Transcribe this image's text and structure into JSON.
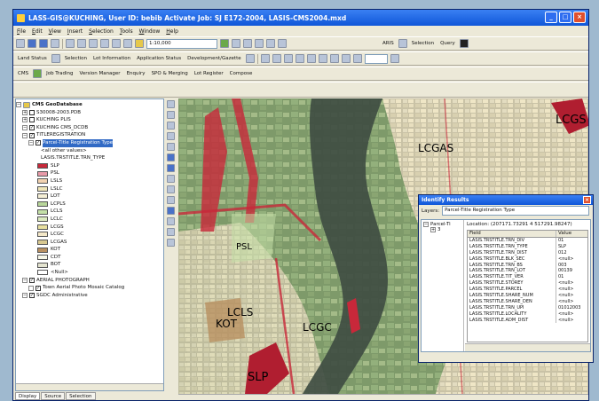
{
  "window": {
    "title": "LASS-GIS@KUCHING, User ID: bebib    Activate Job: SJ E172-2004,      LASIS-CMS2004.mxd"
  },
  "menu": [
    "File",
    "Edit",
    "View",
    "Insert",
    "Selection",
    "Tools",
    "Window",
    "Help"
  ],
  "toolbar1": {
    "scale": "1:10,000",
    "arcis_label": "ARIS",
    "selection_label": "Selection",
    "query_label": "Query"
  },
  "toolbar2": {
    "items": [
      "Land Status",
      "Selection",
      "Lot Information",
      "Application Status",
      "Development/Gazette"
    ]
  },
  "toolbar3": {
    "items": [
      "CMS",
      "Job Trading",
      "Version Manager",
      "Enquiry",
      "SPO & Merging",
      "Lot Register",
      "Compose"
    ]
  },
  "toc": {
    "root": "CMS GeoDatabase",
    "items": [
      {
        "label": "S30008-2003.PDB",
        "checked": false,
        "indent": 1
      },
      {
        "label": "KUCHING PLIS",
        "checked": false,
        "indent": 1
      },
      {
        "label": "KUCHING CMS_DCDB",
        "checked": true,
        "indent": 1
      },
      {
        "label": "TITLEREGISTRATION",
        "checked": true,
        "indent": 1
      },
      {
        "label": "Parcel-Title Registration Type",
        "checked": true,
        "indent": 2,
        "selected": true
      },
      {
        "label": "<all other values>",
        "indent": 4
      },
      {
        "label": "LASIS.TRSTITLE.TRN_TYPE",
        "indent": 4
      }
    ],
    "legend": [
      {
        "label": "SLP",
        "color": "#c8283a"
      },
      {
        "label": "PSL",
        "color": "#e89aa8"
      },
      {
        "label": "LSLS",
        "color": "#f2d2b0"
      },
      {
        "label": "LSLC",
        "color": "#f0e6b8"
      },
      {
        "label": "LOT",
        "color": "#f6f0d6"
      },
      {
        "label": "LCPLS",
        "color": "#b8d69a"
      },
      {
        "label": "LCLS",
        "color": "#c4e0a8"
      },
      {
        "label": "LCLC",
        "color": "#dcebc0"
      },
      {
        "label": "LCGS",
        "color": "#e8e0a0"
      },
      {
        "label": "LCGC",
        "color": "#f4e8c8"
      },
      {
        "label": "LCGAS",
        "color": "#d8c890"
      },
      {
        "label": "KOT",
        "color": "#b89060"
      },
      {
        "label": "CDT",
        "color": "#f8f8e8"
      },
      {
        "label": "BOT",
        "color": "#e4e4d0"
      },
      {
        "label": "<Null>",
        "color": "#ffffff"
      }
    ],
    "after": [
      {
        "label": "AERIAL PHOTOGRAPH",
        "checked": true,
        "indent": 1
      },
      {
        "label": "Town Aerial Photo Mosaic Catalog",
        "checked": true,
        "indent": 2
      },
      {
        "label": "SGDC Administrative",
        "checked": true,
        "indent": 1
      }
    ],
    "tabs": [
      "Display",
      "Source",
      "Selection"
    ]
  },
  "map_labels": [
    "LCGS",
    "LCGAS",
    "PSL",
    "LCLS",
    "KOT",
    "LCGC",
    "SLP"
  ],
  "identify": {
    "title": "Identify Results",
    "layers_label": "Layers:",
    "layer_value": "Parcel-Title Registration Type",
    "tree_item": "Parcel-Ti",
    "tree_child": "3",
    "location": "Location: (207171.73291 4 517291.98247)",
    "col_field": "Field",
    "col_value": "Value",
    "rows": [
      [
        "LASIS.TRSTITLE.TRN_DIV",
        "01"
      ],
      [
        "LASIS.TRSTITLE.TRN_TYPE",
        "SLP"
      ],
      [
        "LASIS.TRSTITLE.TRN_DIST",
        "012"
      ],
      [
        "LASIS.TRSTITLE.BLK_SEC",
        "<null>"
      ],
      [
        "LASIS.TRSTITLE.TRN_BS",
        "003"
      ],
      [
        "LASIS.TRSTITLE.TRN_LOT",
        "00139"
      ],
      [
        "LASIS.TRSTITLE.TIT_VER",
        "01"
      ],
      [
        "LASIS.TRSTITLE.STOREY",
        "<null>"
      ],
      [
        "LASIS.TRSTITLE.PARCEL",
        "<null>"
      ],
      [
        "LASIS.TRSTITLE.SHARE_NUM",
        "<null>"
      ],
      [
        "LASIS.TRSTITLE.SHARE_DEN",
        "<null>"
      ],
      [
        "LASIS.TRSTITLE.TRN_UPI",
        "01012003"
      ],
      [
        "LASIS.TRSTITLE.LOCALITY",
        "<null>"
      ],
      [
        "LASIS.TRSTITLE.ADM_DIST",
        "<null>"
      ]
    ]
  }
}
